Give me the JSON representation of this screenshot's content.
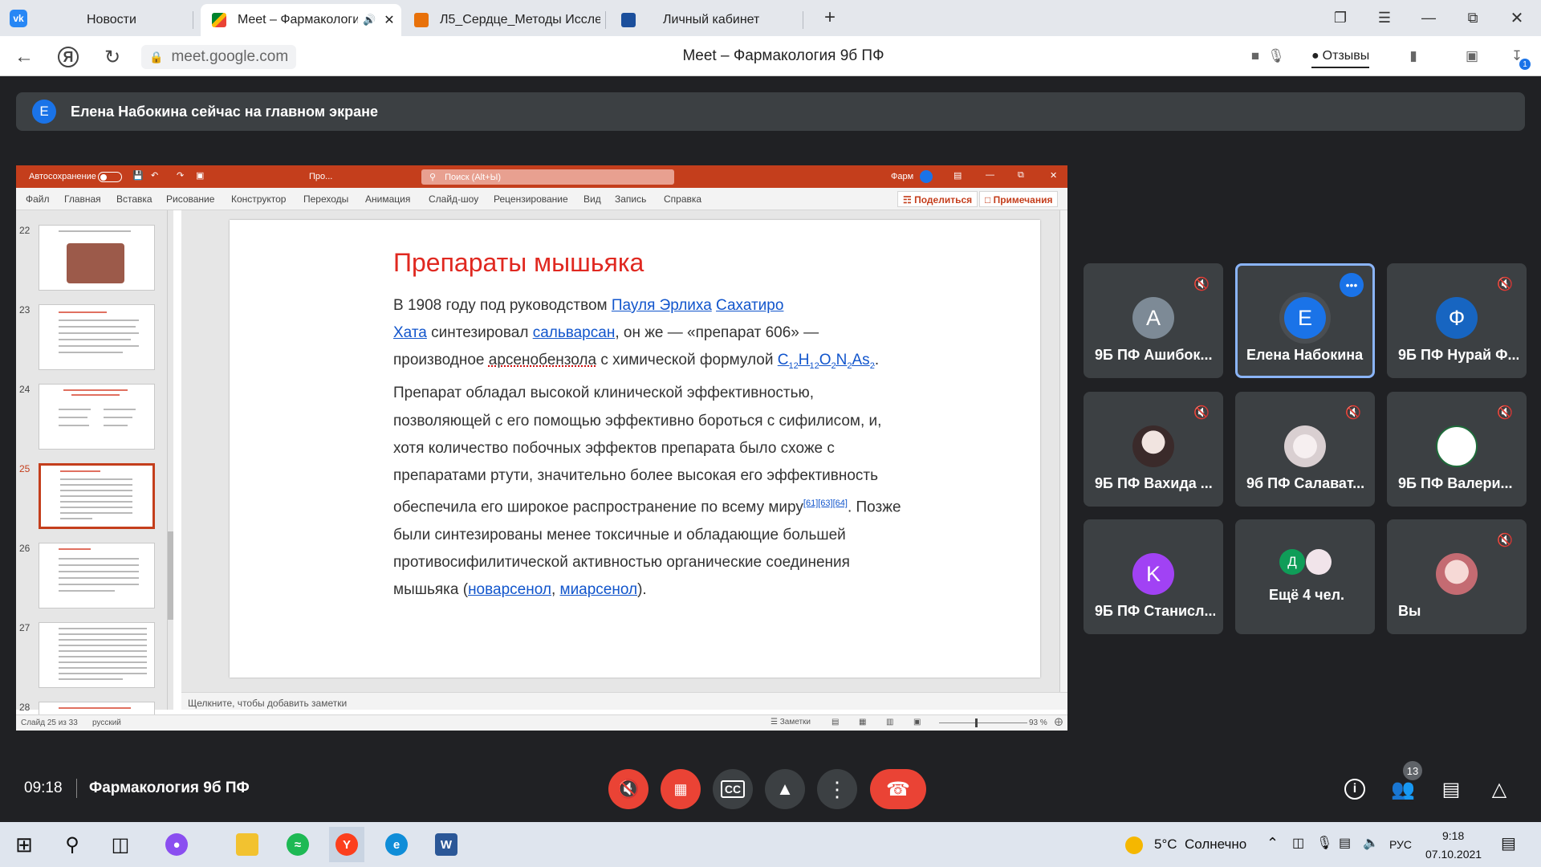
{
  "browser": {
    "tabs": [
      {
        "title": "Новости"
      },
      {
        "title": "Meet – Фармакологи"
      },
      {
        "title": "Л5_Сердце_Методы Иссле"
      },
      {
        "title": "Личный кабинет"
      }
    ],
    "new_tab": "+",
    "url": "meet.google.com",
    "page_title": "Meet – Фармакология 9б ПФ",
    "feedback_label": "Отзывы",
    "download_count": "1"
  },
  "banner": {
    "avatar_letter": "E",
    "text": "Елена Набокина сейчас на главном экране"
  },
  "presentation": {
    "autosave_label": "Автосохранение",
    "file_name": "Про...",
    "search_placeholder": "Поиск (Alt+Ы)",
    "user_short": "Фарм",
    "ribbon_tabs": [
      "Файл",
      "Главная",
      "Вставка",
      "Рисование",
      "Конструктор",
      "Переходы",
      "Анимация",
      "Слайд-шоу",
      "Рецензирование",
      "Вид",
      "Запись",
      "Справка"
    ],
    "share_label": "Поделиться",
    "comments_label": "Примечания",
    "thumbnails": [
      {
        "num": "22",
        "title": ""
      },
      {
        "num": "23",
        "title": ""
      },
      {
        "num": "24",
        "title": ""
      },
      {
        "num": "25",
        "title": ""
      },
      {
        "num": "26",
        "title": ""
      },
      {
        "num": "27",
        "title": ""
      },
      {
        "num": "28",
        "title": ""
      }
    ],
    "slide": {
      "title": "Препараты мышьяка",
      "p1": "В 1908 году под руководством ",
      "link_ehrlich": "Пауля Эрлиха",
      "link_hata1": "Сахатиро",
      "link_hata2": "Хата",
      "p2": " синтезировал ",
      "link_salvarsan": "сальварсан",
      "p3": ", он же — «препарат 606» — производное ",
      "arseno": "арсенобензола",
      "p4": " с химической формулой ",
      "formula_c": "C",
      "formula_c_sub": "12",
      "formula_h": "H",
      "formula_h_sub": "12",
      "formula_o": "O",
      "formula_o_sub": "2",
      "formula_n": "N",
      "formula_n_sub": "2",
      "formula_as": "As",
      "formula_as_sub": "2",
      "p5": ". Препарат обладал высокой клинической эффективностью, позволяющей с его помощью эффективно бороться с сифилисом, и, хотя количество побочных эффектов препарата было схоже с препаратами ртути, значительно более высокая его эффективность обеспечила его широкое распространение по всему миру",
      "refs": "[61][63][64]",
      "p6": ". Позже были синтезированы менее токсичные и обладающие большей противосифилитической активностью органические соединения мышьяка (",
      "link_neo": "новарсенол",
      "comma": ", ",
      "link_mia": "миарсенол",
      "p7": ")."
    },
    "notes_placeholder": "Щелкните, чтобы добавить заметки",
    "status_slide": "Слайд 25 из 33",
    "status_lang": "русский",
    "status_notes": "Заметки",
    "zoom": "93 %"
  },
  "participants": [
    {
      "letter": "A",
      "name": "9Б ПФ Ашибок...",
      "color": "#7d8a96",
      "muted": true
    },
    {
      "letter": "E",
      "name": "Елена Набокина",
      "color": "#1a73e8",
      "muted": false,
      "active": true
    },
    {
      "letter": "Ф",
      "name": "9Б ПФ Нурай Ф...",
      "color": "#1765c1",
      "muted": true
    },
    {
      "letter": "",
      "name": "9Б ПФ Вахида ...",
      "color": "#d8d0d2",
      "muted": true
    },
    {
      "letter": "",
      "name": "9б ПФ Салават...",
      "color": "#efe4e6",
      "muted": true
    },
    {
      "letter": "",
      "name": "9Б ПФ Валери...",
      "color": "#ffffff",
      "muted": true
    },
    {
      "letter": "K",
      "name": "9Б ПФ Станисл...",
      "color": "#a142f4",
      "muted": false
    },
    {
      "letter": "Д",
      "name": "Ещё 4 чел.",
      "color": "#0f9d58",
      "muted": false
    },
    {
      "letter": "",
      "name": "Вы",
      "color": "#f2c6c8",
      "muted": true
    }
  ],
  "meeting": {
    "time": "09:18",
    "name": "Фармакология 9б ПФ",
    "people_count": "13"
  },
  "taskbar": {
    "weather": "5°C  Солнечно",
    "lang": "РУС",
    "clock_time": "9:18",
    "clock_date": "07.10.2021",
    "word_letter": "W"
  },
  "colors": {
    "meet_bg": "#202124",
    "tile_bg": "#3c4043",
    "red": "#ea4335",
    "ppt_accent": "#c43e1c"
  }
}
